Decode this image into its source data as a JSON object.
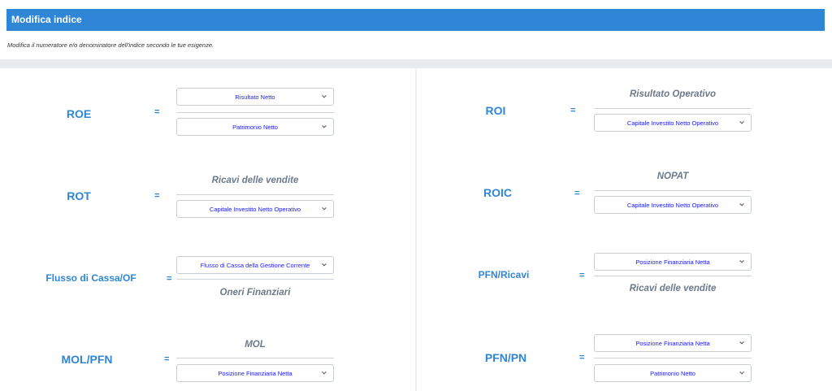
{
  "header": {
    "title": "Modifica indice"
  },
  "subtitle": "Modifica il numeratore e/o denominatore dell'indice secondo le tue esigenze.",
  "eq_sign": "=",
  "chevron_icon": "chevron-down-icon",
  "ratios": {
    "roe": {
      "name": "ROE",
      "numerator": "Risultato Netto",
      "denominator": "Patrimonio Netto"
    },
    "roi": {
      "name": "ROI",
      "numerator": "Risultato Operativo",
      "denominator": "Capitale Investito Netto Operativo"
    },
    "rot": {
      "name": "ROT",
      "numerator": "Ricavi delle vendite",
      "denominator": "Capitale Investito Netto Operativo"
    },
    "roic": {
      "name": "ROIC",
      "numerator": "NOPAT",
      "denominator": "Capitale Investito Netto Operativo"
    },
    "flusso": {
      "name": "Flusso di Cassa/OF",
      "numerator": "Flusso di Cassa della Gestione Corrente",
      "denominator": "Oneri Finanziari"
    },
    "pfn_ricavi": {
      "name": "PFN/Ricavi",
      "numerator": "Posizione Finanziaria Netta",
      "denominator": "Ricavi delle vendite"
    },
    "mol_pfn": {
      "name": "MOL/PFN",
      "numerator": "MOL",
      "denominator": "Posizione Finanziaria Netta"
    },
    "pfn_pn": {
      "name": "PFN/PN",
      "numerator": "Posizione Finanziaria Netta",
      "denominator": "Patrimonio Netto"
    }
  }
}
